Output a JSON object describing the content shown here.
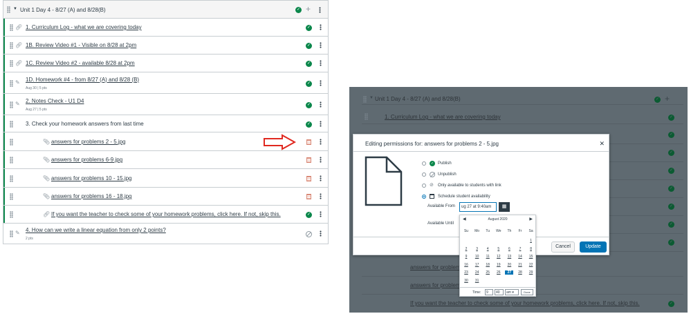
{
  "left": {
    "module_title": "Unit 1 Day 4 - 8/27 (A) and 8/28(B)",
    "items": [
      {
        "title": "1. Curriculum Log - what we are covering today",
        "sub": ""
      },
      {
        "title": "1B. Review Video #1 - Visible on 8/28 at 2pm",
        "sub": ""
      },
      {
        "title": "1C. Review Video #2 - available 8/28 at 2pm",
        "sub": ""
      },
      {
        "title": "1D. Homework #4 - from 8/27 (A) and 8/28 (B)",
        "sub": "Aug 30  |  5 pts"
      },
      {
        "title": "2. Notes Check - U1 D4",
        "sub": "Aug 27  |  5 pts"
      },
      {
        "title": "3. Check your homework answers from last time",
        "sub": ""
      },
      {
        "title": "answers for problems 2 - 5.jpg",
        "sub": ""
      },
      {
        "title": "answers for problems 6-9.jpg",
        "sub": ""
      },
      {
        "title": "answers for problems 10 - 15.jpg",
        "sub": ""
      },
      {
        "title": "answers for problems 16 - 18.jpg",
        "sub": ""
      },
      {
        "title": "If you want the teacher to check some of your homework problems, click here. If not, skip this.",
        "sub": ""
      },
      {
        "title": "4. How can we write a linear equation from only 2 points?",
        "sub": "2 pts"
      }
    ]
  },
  "right": {
    "module_title": "Unit 1 Day 4 - 8/27 (A) and 8/28(B)",
    "item1": "1. Curriculum Log - what we are covering today",
    "item_a": "answers for problem",
    "item_b": "answers for problem",
    "item_last": "If you want the teacher to check some of your homework problems, click here. If not, skip this.",
    "dialog": {
      "title": "Editing permissions for: answers for problems 2 - 5.jpg",
      "opt_publish": "Publish",
      "opt_unpublish": "Unpublish",
      "opt_link": "Only available to students with link",
      "opt_schedule": "Schedule student availability",
      "available_from_label": "Available From",
      "available_from_value": "ug 27 at 9:40am",
      "available_until_label": "Available Until",
      "cancel": "Cancel",
      "update": "Update"
    },
    "calendar": {
      "month": "August 2020",
      "weekdays": [
        "Su",
        "Mo",
        "Tu",
        "We",
        "Th",
        "Fr",
        "Sa"
      ],
      "days": [
        "1",
        "2",
        "3",
        "4",
        "5",
        "6",
        "7",
        "8",
        "9",
        "10",
        "11",
        "12",
        "13",
        "14",
        "15",
        "16",
        "17",
        "18",
        "19",
        "20",
        "21",
        "22",
        "23",
        "24",
        "25",
        "26",
        "27",
        "28",
        "29",
        "30",
        "31"
      ],
      "selected_day": "27",
      "time_label": "Time:",
      "hour": "9",
      "minute": "40",
      "ampm": "am",
      "done": "Done"
    }
  },
  "colors": {
    "published": "#0b874b",
    "accent": "#0374b5",
    "arrow": "#e0281f"
  }
}
